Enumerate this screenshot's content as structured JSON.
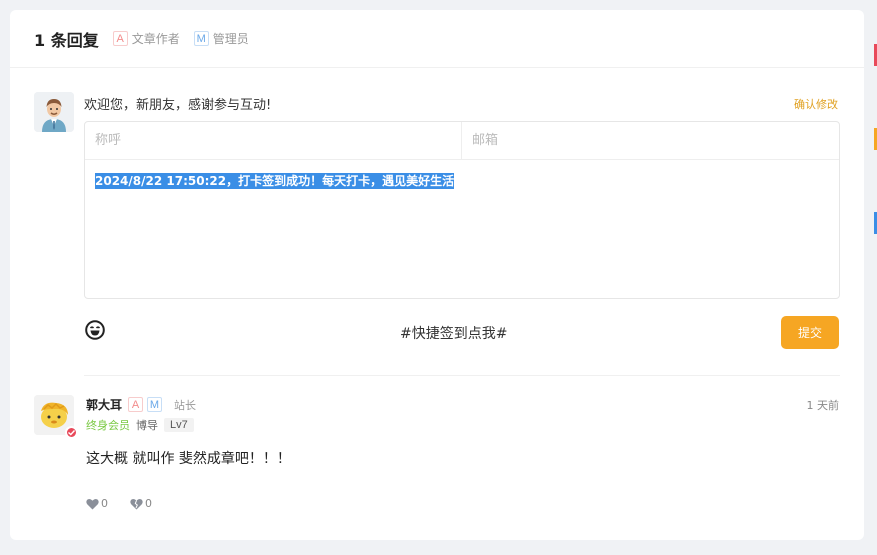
{
  "header": {
    "title": "1 条回复",
    "legend": [
      {
        "badge": "A",
        "label": "文章作者"
      },
      {
        "badge": "M",
        "label": "管理员"
      }
    ]
  },
  "form": {
    "welcome": "欢迎您，新朋友，感谢参与互动!",
    "confirm_label": "确认修改",
    "name_placeholder": "称呼",
    "email_placeholder": "邮箱",
    "content_value": "2024/8/22 17:50:22，打卡签到成功！每天打卡，遇见美好生活",
    "quick_checkin_label": "#快捷签到点我#",
    "submit_label": "提交"
  },
  "comment": {
    "author": "郭大耳",
    "badges": [
      "A",
      "M"
    ],
    "role": "站长",
    "time": "1 天前",
    "member_label": "终身会员",
    "title_label": "博导",
    "level": "Lv7",
    "text": "这大概 就叫作 斐然成章吧！！！",
    "likes": "0",
    "dislikes": "0"
  },
  "colors": {
    "accent": "#f6a623",
    "selection": "#3a8ee6",
    "member": "#7ac943"
  }
}
